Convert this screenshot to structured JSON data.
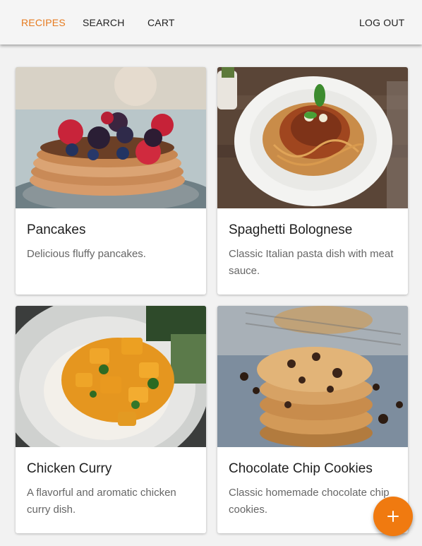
{
  "nav": {
    "recipes": "RECIPES",
    "search": "SEARCH",
    "cart": "CART",
    "logout": "LOG OUT",
    "active_color": "#e67a1e"
  },
  "recipes": [
    {
      "title": "Pancakes",
      "description": "Delicious fluffy pancakes."
    },
    {
      "title": "Spaghetti Bolognese",
      "description": "Classic Italian pasta dish with meat sauce."
    },
    {
      "title": "Chicken Curry",
      "description": "A flavorful and aromatic chicken curry dish."
    },
    {
      "title": "Chocolate Chip Cookies",
      "description": "Classic homemade chocolate chip cookies."
    }
  ],
  "fab": {
    "icon": "plus-icon",
    "color": "#f07a10"
  }
}
